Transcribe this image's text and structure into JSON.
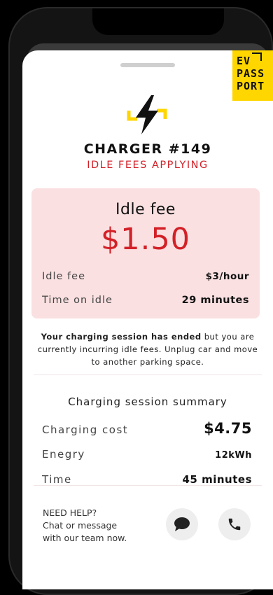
{
  "brand": {
    "logo_lines": [
      "EV",
      "PASS",
      "PORT"
    ],
    "accent_color": "#FFD600"
  },
  "charger": {
    "title": "CHARGER #149",
    "status": "IDLE FEES APPLYING",
    "status_color": "#d32027",
    "icon": "charger-bolt-icon"
  },
  "idle_card": {
    "title": "Idle fee",
    "amount": "$1.50",
    "rows": [
      {
        "label": "Idle fee",
        "value": "$3/hour"
      },
      {
        "label": "Time on idle",
        "value": "29 minutes"
      }
    ],
    "background": "#fae0e1"
  },
  "message": {
    "bold": "Your charging session has ended",
    "text": " but you are currently incurring idle fees. Unplug car and move to another parking space."
  },
  "summary": {
    "title": "Charging session summary",
    "rows": [
      {
        "label": "Charging cost",
        "value": "$4.75"
      },
      {
        "label": "Enegry",
        "value": "12kWh"
      },
      {
        "label": "Time",
        "value": "45 minutes"
      }
    ]
  },
  "help": {
    "lines": [
      "NEED HELP?",
      "Chat or message",
      "with our team now."
    ],
    "chat_icon": "chat-bubble-icon",
    "phone_icon": "phone-icon"
  }
}
